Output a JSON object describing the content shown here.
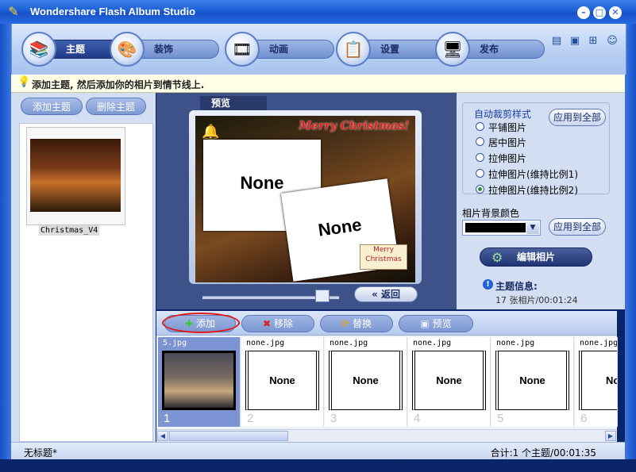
{
  "window": {
    "title": "Wondershare Flash Album Studio",
    "icon": "app-logo-icon"
  },
  "nav": {
    "tabs": [
      {
        "label": "主题",
        "icon": "theme-book-icon",
        "active": true
      },
      {
        "label": "装饰",
        "icon": "palette-icon",
        "active": false
      },
      {
        "label": "动画",
        "icon": "film-reel-icon",
        "active": false
      },
      {
        "label": "设置",
        "icon": "settings-clipboard-icon",
        "active": false
      },
      {
        "label": "发布",
        "icon": "publish-window-icon",
        "active": false
      }
    ],
    "toolbar_icons": [
      "new-document-icon",
      "save-icon",
      "add-image-icon",
      "user-icon"
    ]
  },
  "hint": {
    "text": "添加主题, 然后添加你的相片到情节线上."
  },
  "theme_panel": {
    "add_button": "添加主题",
    "delete_button": "删除主题",
    "themes": [
      {
        "name": "Christmas_V4"
      }
    ]
  },
  "preview": {
    "tab_label": "预览",
    "placeholder_1": "None",
    "placeholder_2": "None",
    "caption_top": "Merry Christmas!",
    "sign_line_1": "Merry",
    "sign_line_2": "Christmas",
    "back_button": "返回",
    "slider_value": 0.88
  },
  "crop_style": {
    "title": "自动裁剪样式",
    "apply_all": "应用到全部",
    "options": [
      {
        "label": "平铺图片",
        "selected": false
      },
      {
        "label": "居中图片",
        "selected": false
      },
      {
        "label": "拉伸图片",
        "selected": false
      },
      {
        "label": "拉伸图片(维持比例1)",
        "selected": false
      },
      {
        "label": "拉伸图片(维持比例2)",
        "selected": true
      }
    ]
  },
  "bg_color": {
    "label": "相片背景颜色",
    "value": "#000000",
    "apply_all": "应用到全部"
  },
  "edit_photo_button": "编辑相片",
  "theme_info": {
    "title": "主题信息:",
    "value": "17 张相片/00:01:24"
  },
  "storyboard": {
    "buttons": {
      "add": "添加",
      "remove": "移除",
      "replace": "替换",
      "preview": "预览"
    },
    "slots": [
      {
        "file": "5.jpg",
        "index": "1",
        "selected": true,
        "content": ""
      },
      {
        "file": "none.jpg",
        "index": "2",
        "selected": false,
        "content": "None"
      },
      {
        "file": "none.jpg",
        "index": "3",
        "selected": false,
        "content": "None"
      },
      {
        "file": "none.jpg",
        "index": "4",
        "selected": false,
        "content": "None"
      },
      {
        "file": "none.jpg",
        "index": "5",
        "selected": false,
        "content": "None"
      },
      {
        "file": "none.jpg",
        "index": "6",
        "selected": false,
        "content": "No"
      }
    ]
  },
  "status": {
    "left": "无标题*",
    "right": "合计:1 个主题/00:01:35"
  }
}
